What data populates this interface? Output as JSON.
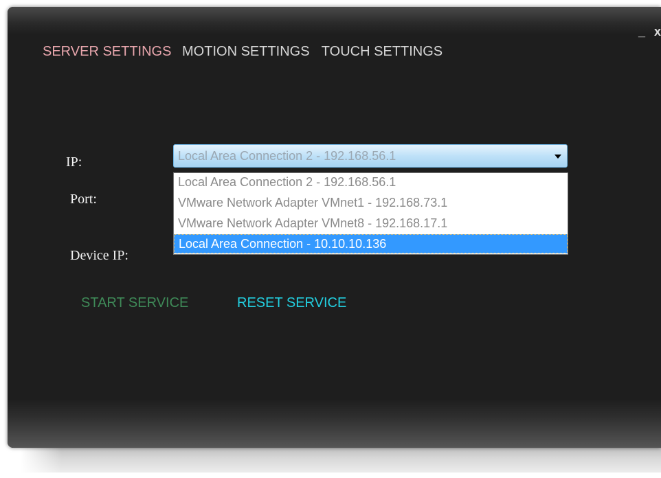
{
  "window": {
    "controls": {
      "minimize": "_",
      "close": "x"
    }
  },
  "nav": {
    "tabs": [
      {
        "label": "SERVER SETTINGS",
        "active": true
      },
      {
        "label": "MOTION SETTINGS",
        "active": false
      },
      {
        "label": "TOUCH SETTINGS",
        "active": false
      }
    ]
  },
  "form": {
    "ip_label": "IP:",
    "port_label": "Port:",
    "device_ip_label": "Device IP:",
    "ip_select": {
      "value": "Local Area Connection 2 - 192.168.56.1",
      "options": [
        "Local Area Connection 2 - 192.168.56.1",
        "VMware Network Adapter VMnet1 - 192.168.73.1",
        "VMware Network Adapter VMnet8 - 192.168.17.1",
        "Local Area Connection - 10.10.10.136"
      ],
      "highlighted_option": "Local Area Connection - 10.10.10.136"
    }
  },
  "actions": {
    "start_label": "START SERVICE",
    "reset_label": "RESET SERVICE"
  },
  "colors": {
    "window_bg": "#1e1e1e",
    "active_tab": "#e8a6ad",
    "tab": "#d7d7d7",
    "start_service": "#3f8a58",
    "reset_service": "#22cfe0",
    "selection": "#3399ff"
  }
}
